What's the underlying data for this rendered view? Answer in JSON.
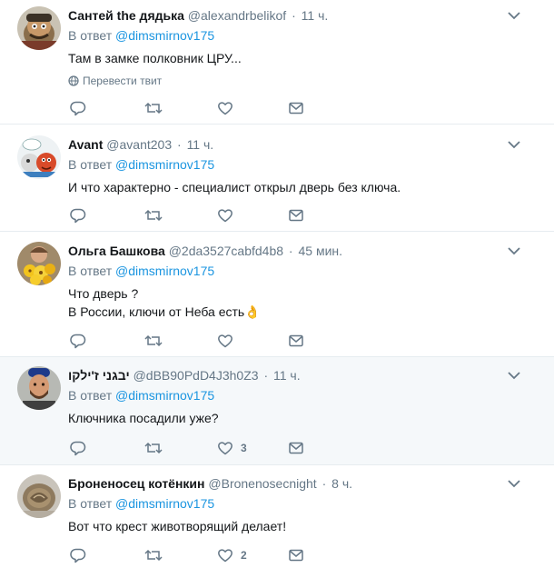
{
  "tweets": [
    {
      "name": "Сантей the дядька",
      "handle": "@alexandrbelikof",
      "sep": "·",
      "time": "11 ч.",
      "reply_prefix": "В ответ",
      "reply_to": "@dimsmirnov175",
      "lines": [
        "Там в замке полковник ЦРУ..."
      ],
      "translate": "Перевести твит",
      "likes": ""
    },
    {
      "name": "Avant",
      "handle": "@avant203",
      "sep": "·",
      "time": "11 ч.",
      "reply_prefix": "В ответ",
      "reply_to": "@dimsmirnov175",
      "lines": [
        "И что характерно - специалист открыл дверь без ключа."
      ],
      "likes": ""
    },
    {
      "name": "Ольга Башкова",
      "handle": "@2da3527cabfd4b8",
      "sep": "·",
      "time": "45 мин.",
      "reply_prefix": "В ответ",
      "reply_to": "@dimsmirnov175",
      "lines": [
        "Что дверь ?",
        "В России, ключи от Неба есть👌"
      ],
      "likes": ""
    },
    {
      "name": "יבגני ז'ילקו",
      "handle": "@dBB90PdD4J3h0Z3",
      "sep": "·",
      "time": "11 ч.",
      "reply_prefix": "В ответ",
      "reply_to": "@dimsmirnov175",
      "lines": [
        "Ключника посадили уже?"
      ],
      "likes": "3"
    },
    {
      "name": "Броненосец котёнкин",
      "handle": "@Bronenosecnight",
      "sep": "·",
      "time": "8 ч.",
      "reply_prefix": "В ответ",
      "reply_to": "@dimsmirnov175",
      "lines": [
        "Вот что крест животворящий делает!"
      ],
      "likes": "2"
    }
  ],
  "colors": {
    "link": "#1b95e0",
    "muted": "#657786",
    "text": "#14171a",
    "divider": "#e6ecf0",
    "highlight_bg": "#f5f8fa"
  },
  "icons": [
    "reply-icon",
    "retweet-icon",
    "like-icon",
    "direct-message-icon",
    "chevron-down-icon",
    "globe-icon"
  ]
}
